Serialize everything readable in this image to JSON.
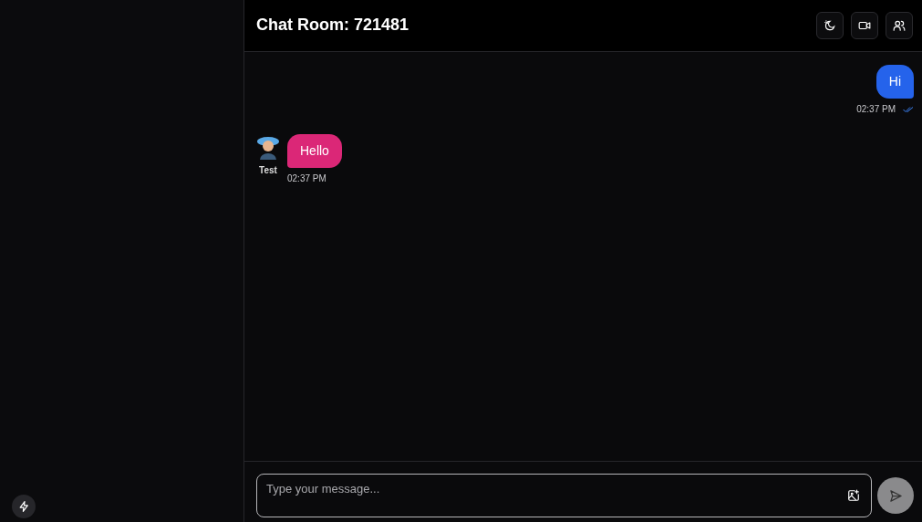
{
  "header": {
    "title": "Chat Room: 721481"
  },
  "messages": [
    {
      "kind": "sent",
      "text": "Hi",
      "time": "02:37 PM",
      "read": true
    },
    {
      "kind": "received",
      "sender": "Test",
      "text": "Hello",
      "time": "02:37 PM"
    }
  ],
  "composer": {
    "placeholder": "Type your message..."
  }
}
